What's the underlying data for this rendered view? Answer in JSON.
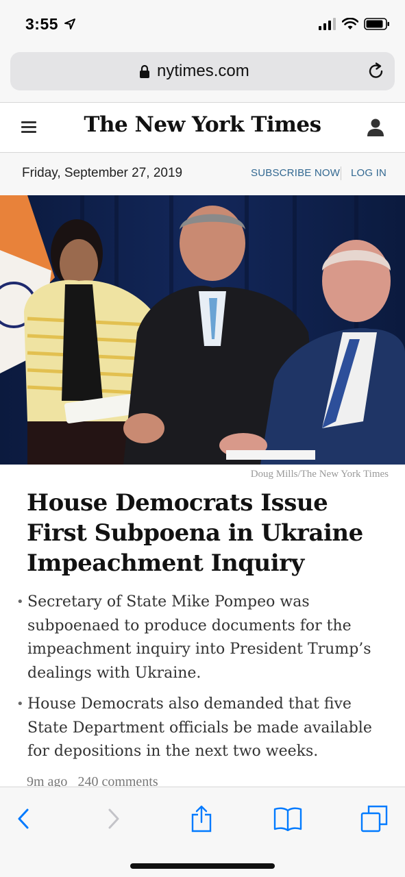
{
  "status_bar": {
    "time": "3:55"
  },
  "browser": {
    "url": "nytimes.com"
  },
  "site": {
    "logo": "The New York Times",
    "date": "Friday, September 27, 2019",
    "subscribe_label": "SUBSCRIBE NOW",
    "login_label": "LOG IN"
  },
  "article": {
    "photo_credit": "Doug Mills/The New York Times",
    "headline": "House Democrats Issue First Subpoena in Ukraine Impeachment Inquiry",
    "summary": [
      "Secretary of State Mike Pompeo was subpoenaed to produce documents for the impeachment inquiry into President Trump’s dealings with Ukraine.",
      "House Democrats also demanded that five State Department officials be made available for depositions in the next two weeks."
    ],
    "time_ago": "9m ago",
    "comments": "240 comments"
  },
  "colors": {
    "link": "#326891",
    "ios_blue": "#007aff",
    "chrome_bg": "#f7f7f7"
  },
  "icons": {
    "status": [
      "location-arrow-icon",
      "signal-icon",
      "wifi-icon",
      "battery-icon"
    ],
    "toolbar": [
      "back-icon",
      "forward-icon",
      "share-icon",
      "bookmarks-icon",
      "tabs-icon"
    ]
  }
}
